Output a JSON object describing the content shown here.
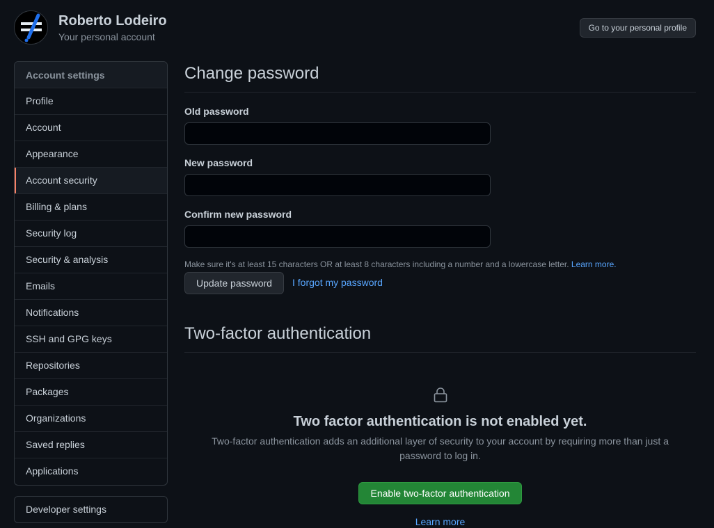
{
  "header": {
    "name": "Roberto Lodeiro",
    "subtitle": "Your personal account",
    "profile_button": "Go to your personal profile",
    "avatar_icon": "logo-avatar-icon"
  },
  "sidebar": {
    "heading": "Account settings",
    "items": [
      {
        "label": "Profile"
      },
      {
        "label": "Account"
      },
      {
        "label": "Appearance"
      },
      {
        "label": "Account security",
        "selected": true
      },
      {
        "label": "Billing & plans"
      },
      {
        "label": "Security log"
      },
      {
        "label": "Security & analysis"
      },
      {
        "label": "Emails"
      },
      {
        "label": "Notifications"
      },
      {
        "label": "SSH and GPG keys"
      },
      {
        "label": "Repositories"
      },
      {
        "label": "Packages"
      },
      {
        "label": "Organizations"
      },
      {
        "label": "Saved replies"
      },
      {
        "label": "Applications"
      }
    ],
    "developer_settings": "Developer settings"
  },
  "password": {
    "title": "Change password",
    "old_label": "Old password",
    "old_value": "",
    "new_label": "New password",
    "new_value": "",
    "confirm_label": "Confirm new password",
    "confirm_value": "",
    "note": "Make sure it's at least 15 characters OR at least 8 characters including a number and a lowercase letter.",
    "learn_more": "Learn more.",
    "update_button": "Update password",
    "forgot_link": "I forgot my password"
  },
  "two_factor": {
    "title": "Two-factor authentication",
    "lock_icon": "lock-icon",
    "heading": "Two factor authentication is not enabled yet.",
    "description": "Two-factor authentication adds an additional layer of security to your account by requiring more than just a password to log in.",
    "enable_button": "Enable two-factor authentication",
    "learn_more": "Learn more"
  },
  "colors": {
    "background": "#0d1117",
    "accent_selected": "#f78166",
    "link": "#58a6ff",
    "primary_button": "#238636"
  }
}
